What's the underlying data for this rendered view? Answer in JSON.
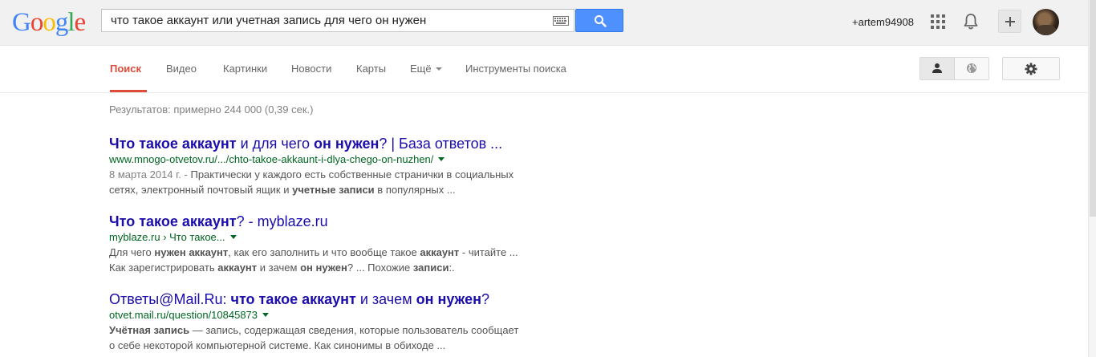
{
  "logo": {
    "letters": [
      "G",
      "o",
      "o",
      "g",
      "l",
      "e"
    ],
    "colors": [
      "#4285f4",
      "#ea4335",
      "#fbbc05",
      "#4285f4",
      "#34a853",
      "#ea4335"
    ]
  },
  "search": {
    "query": "что такое аккаунт или учетная запись для чего он нужен"
  },
  "header": {
    "username": "+artem94908"
  },
  "tabs": [
    {
      "label": "Поиск",
      "active": true
    },
    {
      "label": "Видео",
      "active": false
    },
    {
      "label": "Картинки",
      "active": false
    },
    {
      "label": "Новости",
      "active": false
    },
    {
      "label": "Карты",
      "active": false
    },
    {
      "label": "Ещё",
      "active": false
    },
    {
      "label": "Инструменты поиска",
      "active": false
    }
  ],
  "result_stats": "Результатов: примерно 244 000 (0,39 сек.)",
  "results": [
    {
      "title": [
        {
          "t": "Что такое аккаунт",
          "b": true
        },
        {
          "t": " и для чего ",
          "b": false
        },
        {
          "t": "он нужен",
          "b": true
        },
        {
          "t": "? | База ответов ...",
          "b": false
        }
      ],
      "url": "www.mnogo-otvetov.ru/.../chto-takoe-akkaunt-i-dlya-chego-on-nuzhen/",
      "snippet": [
        {
          "t": "8 марта 2014 г. - ",
          "b": false,
          "date": true
        },
        {
          "t": "Практически у каждого есть собственные странички в социальных сетях, электронный почтовый ящик и ",
          "b": false
        },
        {
          "t": "учетные записи",
          "b": true
        },
        {
          "t": " в популярных ...",
          "b": false
        }
      ]
    },
    {
      "title": [
        {
          "t": "Что такое аккаунт",
          "b": true
        },
        {
          "t": "? - myblaze.ru",
          "b": false
        }
      ],
      "url": "myblaze.ru › Что такое...",
      "snippet": [
        {
          "t": "Для чего ",
          "b": false
        },
        {
          "t": "нужен аккаунт",
          "b": true
        },
        {
          "t": ", как его заполнить и что вообще такое ",
          "b": false
        },
        {
          "t": "аккаунт",
          "b": true
        },
        {
          "t": " - читайте ... Как зарегистрировать ",
          "b": false
        },
        {
          "t": "аккаунт",
          "b": true
        },
        {
          "t": " и зачем ",
          "b": false
        },
        {
          "t": "он нужен",
          "b": true
        },
        {
          "t": "? ... Похожие ",
          "b": false
        },
        {
          "t": "записи",
          "b": true
        },
        {
          "t": ":.",
          "b": false
        }
      ]
    },
    {
      "title": [
        {
          "t": "Ответы@Mail.Ru: ",
          "b": false
        },
        {
          "t": "что такое аккаунт",
          "b": true
        },
        {
          "t": " и зачем ",
          "b": false
        },
        {
          "t": "он нужен",
          "b": true
        },
        {
          "t": "?",
          "b": false
        }
      ],
      "url": "otvet.mail.ru/question/10845873",
      "snippet": [
        {
          "t": "Учётная запись",
          "b": true
        },
        {
          "t": " — запись, содержащая сведения, которые пользователь сообщает о себе некоторой компьютерной системе. Как синонимы в обиходе ...",
          "b": false
        }
      ]
    }
  ],
  "colors": {
    "accent_red": "#dd4b39",
    "link_blue": "#1a0dab",
    "url_green": "#006621",
    "search_blue": "#4d90fe"
  }
}
